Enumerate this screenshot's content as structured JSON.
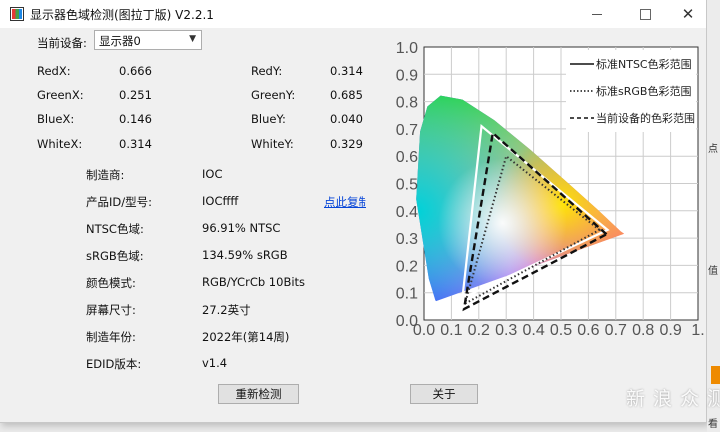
{
  "window": {
    "title": "显示器色域检测(图拉丁版) V2.2.1",
    "controls": {
      "minimize": "—",
      "maximize": "☐",
      "close": "✕"
    }
  },
  "device": {
    "label": "当前设备:",
    "selected": "显示器0"
  },
  "coords": [
    {
      "label": "RedX:",
      "value": "0.666"
    },
    {
      "label": "RedY:",
      "value": "0.314"
    },
    {
      "label": "GreenX:",
      "value": "0.251"
    },
    {
      "label": "GreenY:",
      "value": "0.685"
    },
    {
      "label": "BlueX:",
      "value": "0.146"
    },
    {
      "label": "BlueY:",
      "value": "0.040"
    },
    {
      "label": "WhiteX:",
      "value": "0.314"
    },
    {
      "label": "WhiteY:",
      "value": "0.329"
    }
  ],
  "info": [
    {
      "label": "制造商:",
      "value": "IOC"
    },
    {
      "label": "产品ID/型号:",
      "value": "IOCffff"
    },
    {
      "label": "NTSC色域:",
      "value": "96.91% NTSC"
    },
    {
      "label": "sRGB色域:",
      "value": "134.59% sRGB"
    },
    {
      "label": "颜色模式:",
      "value": "RGB/YCrCb 10Bits"
    },
    {
      "label": "屏幕尺寸:",
      "value": "27.2英寸"
    },
    {
      "label": "制造年份:",
      "value": "2022年(第14周)"
    },
    {
      "label": "EDID版本:",
      "value": "v1.4"
    }
  ],
  "copy_link": "点此复制",
  "buttons": {
    "redetect": "重新检测",
    "about": "关于"
  },
  "chart_data": {
    "type": "scatter",
    "xlim": [
      0.0,
      1.0
    ],
    "ylim": [
      0.0,
      1.0
    ],
    "x_ticks": [
      "0.0",
      "0.1",
      "0.2",
      "0.3",
      "0.4",
      "0.5",
      "0.6",
      "0.7",
      "0.8",
      "0.9",
      "1."
    ],
    "y_ticks": [
      "0.0",
      "0.1",
      "0.2",
      "0.3",
      "0.4",
      "0.5",
      "0.6",
      "0.7",
      "0.8",
      "0.9",
      "1.0"
    ],
    "grid": true,
    "legend": [
      {
        "line": "solid",
        "label": "标准NTSC色彩范围"
      },
      {
        "line": "dotted",
        "label": "标准sRGB色彩范围"
      },
      {
        "line": "dashed",
        "label": "当前设备的色彩范围"
      }
    ],
    "legend_position": "top-right",
    "series": [
      {
        "name": "标准NTSC色彩范围",
        "style": "solid",
        "color": "#ffffff",
        "points": [
          [
            0.67,
            0.33
          ],
          [
            0.21,
            0.71
          ],
          [
            0.14,
            0.08
          ]
        ]
      },
      {
        "name": "标准sRGB色彩范围",
        "style": "dotted",
        "color": "#333333",
        "points": [
          [
            0.64,
            0.33
          ],
          [
            0.3,
            0.6
          ],
          [
            0.15,
            0.06
          ]
        ]
      },
      {
        "name": "当前设备的色彩范围",
        "style": "dashed",
        "color": "#111111",
        "points": [
          [
            0.666,
            0.314
          ],
          [
            0.251,
            0.685
          ],
          [
            0.146,
            0.04
          ]
        ]
      }
    ]
  },
  "side": {
    "chars": [
      "点",
      "值",
      "看"
    ],
    "watermark": "新 浪 众 测"
  }
}
